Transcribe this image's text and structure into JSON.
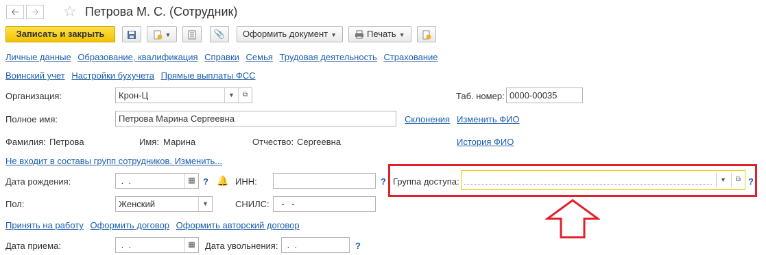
{
  "header": {
    "back_icon": "arrow-left-icon",
    "forward_icon": "arrow-right-icon",
    "favorite_icon": "star-icon",
    "title": "Петрова М. С. (Сотрудник)"
  },
  "toolbar": {
    "save_close": "Записать и закрыть",
    "create_document": "Оформить документ",
    "print": "Печать"
  },
  "nav_links": {
    "row1": [
      "Личные данные",
      "Образование, квалификация",
      "Справки",
      "Семья",
      "Трудовая деятельность",
      "Страхование"
    ],
    "row2": [
      "Воинский учет",
      "Настройки бухучета",
      "Прямые выплаты ФСС"
    ]
  },
  "form": {
    "organization_label": "Организация:",
    "organization_value": "Крон-Ц",
    "tab_number_label": "Таб. номер:",
    "tab_number_value": "0000-00035",
    "full_name_label": "Полное имя:",
    "full_name_value": "Петрова Марина Сергеевна",
    "declensions_link": "Склонения",
    "change_name_link": "Изменить ФИО",
    "surname_label": "Фамилия:",
    "surname_value": "Петрова",
    "first_name_label": "Имя:",
    "first_name_value": "Марина",
    "patronymic_label": "Отчество:",
    "patronymic_value": "Сергеевна",
    "name_history_link": "История ФИО",
    "groups_link": "Не входит в составы групп сотрудников. Изменить...",
    "birth_date_label": "Дата рождения:",
    "birth_date_value": " .  .",
    "inn_label": "ИНН:",
    "access_group_label": "Группа доступа:",
    "gender_label": "Пол:",
    "gender_value": "Женский",
    "snils_label": "СНИЛС:",
    "snils_value": "  -   -",
    "hire_link": "Принять на работу",
    "contract_link": "Оформить договор",
    "author_contract_link": "Оформить авторский договор",
    "hire_date_label": "Дата приема:",
    "hire_date_value": " .  .",
    "dismissal_date_label": "Дата увольнения:",
    "dismissal_date_value": " .  .",
    "help_mark": "?"
  },
  "colors": {
    "link": "#1c5ea8",
    "primary_button": "#f2c200",
    "highlight": "#e0202a",
    "focus_border": "#f0c400"
  }
}
